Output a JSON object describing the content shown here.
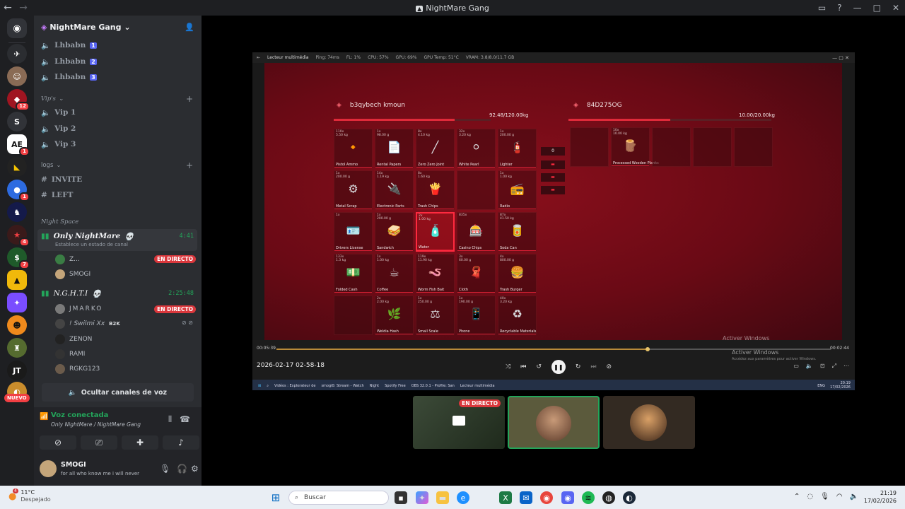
{
  "window": {
    "title": "NightMare Gang"
  },
  "guild": {
    "name": "NightMare Gang"
  },
  "channels": {
    "top": [
      {
        "name": "Lhbabn",
        "tag": "1"
      },
      {
        "name": "Lhbabn",
        "tag": "2"
      },
      {
        "name": "Lhbabn",
        "tag": "3"
      }
    ],
    "vip_category": "Vip's",
    "vip": [
      "Vip 1",
      "Vip 2",
      "Vip 3"
    ],
    "logs_category": "logs",
    "text": [
      "INVITE",
      "LEFT"
    ],
    "night_category": "Night Space",
    "voice1": {
      "name": "Only NightMare",
      "status": "Establece un estado de canal",
      "timer": "4:41",
      "users": [
        {
          "name": "Z...",
          "live": "EN DIRECTO"
        },
        {
          "name": "SMOGI",
          "live": ""
        }
      ]
    },
    "voice2": {
      "name": "N.G.H.T.I",
      "timer": "2:25:48",
      "users": [
        {
          "name": "JMARKO",
          "live": "EN DIRECTO"
        },
        {
          "name": "! Swilmi Xx",
          "tag": "B2K",
          "live": ""
        },
        {
          "name": "ZENON",
          "live": ""
        },
        {
          "name": "RAMI",
          "live": ""
        },
        {
          "name": "RGKG123",
          "live": ""
        }
      ]
    },
    "hide_voice": "Ocultar canales de voz"
  },
  "server_badges": {
    "b1": "12",
    "b2": "1",
    "b3": "1",
    "b4": "4",
    "b5": "7",
    "nuevo": "NUEVO"
  },
  "voice_panel": {
    "status": "Voz conectada",
    "channel": "Only NightMare / NightMare Gang"
  },
  "user": {
    "name": "SMOGI",
    "status": "for all who know me i will never"
  },
  "player": {
    "title": "Lecteur multimédia",
    "stats": [
      "Ping: 74ms",
      "FL: 1%",
      "CPU: 57%",
      "GPU: 69%",
      "GPU Temp: 51°C",
      "VRAM: 3.8/8.0/11.7 GB"
    ],
    "left_inv": {
      "name": "b3qybech kmoun",
      "weight": "92.48/120.00kg",
      "fill": 0.77
    },
    "right_inv": {
      "name": "84D275OG",
      "weight": "10.00/20.00kg",
      "fill": 0.5
    },
    "items": [
      {
        "q": "110x\n5.50 kg",
        "name": "Pistol Ammo",
        "icon": "🔸"
      },
      {
        "q": "1x\n98.00 g",
        "name": "Rental Papers",
        "icon": "📄"
      },
      {
        "q": "8x\n4.10 kg",
        "name": "Zero Zero Joint",
        "icon": "╱"
      },
      {
        "q": "32x\n3.20 kg",
        "name": "White Pearl",
        "icon": "⚪"
      },
      {
        "q": "1x\n200.00 g",
        "name": "Lighter",
        "icon": "🧯"
      },
      {
        "q": "1x\n200.00 g",
        "name": "Metal Scrap",
        "icon": "⚙"
      },
      {
        "q": "14x\n1.19 kg",
        "name": "Electronic Parts",
        "icon": "🔌"
      },
      {
        "q": "8x\n1.60 kg",
        "name": "Trash Chips",
        "icon": "🍟"
      },
      {
        "q": "",
        "name": "",
        "icon": ""
      },
      {
        "q": "1x\n1.00 kg",
        "name": "Radio",
        "icon": "📻"
      },
      {
        "q": "1x",
        "name": "Drivers License",
        "icon": "🪪"
      },
      {
        "q": "1x\n200.00 g",
        "name": "Sandwich",
        "icon": "🥪"
      },
      {
        "q": "2x\n1.00 kg",
        "name": "Water",
        "icon": "🧴"
      },
      {
        "q": "835x",
        "name": "Casino Chips",
        "icon": "🎰"
      },
      {
        "q": "87x\n41.50 kg",
        "name": "Soda Can",
        "icon": "🥫"
      },
      {
        "q": "133x\n1.3 kg",
        "name": "Folded Cash",
        "icon": "💵"
      },
      {
        "q": "1x\n1.00 kg",
        "name": "Coffee",
        "icon": "☕"
      },
      {
        "q": "119x\n11.90 kg",
        "name": "Worm Fish Bait",
        "icon": "🪱"
      },
      {
        "q": "3x\n60.00 g",
        "name": "Cloth",
        "icon": "🧣"
      },
      {
        "q": "4x\n800.00 g",
        "name": "Trash Burger",
        "icon": "🍔"
      },
      {
        "q": "",
        "name": "",
        "icon": ""
      },
      {
        "q": "2x\n2.00 kg",
        "name": "Weldia Hash",
        "icon": "🌿"
      },
      {
        "q": "1x\n250.00 g",
        "name": "Small Scale",
        "icon": "⚖"
      },
      {
        "q": "1x\n190.00 g",
        "name": "Phone",
        "icon": "📱"
      },
      {
        "q": "40x\n3.20 kg",
        "name": "Recyclable Materials",
        "icon": "♻"
      }
    ],
    "right_items": [
      {
        "q": "",
        "name": "",
        "icon": ""
      },
      {
        "q": "10x\n10.00 kg",
        "name": "Processed Wooden Planks",
        "icon": "🪵"
      },
      {
        "q": "",
        "name": "",
        "icon": ""
      },
      {
        "q": "",
        "name": "",
        "icon": ""
      },
      {
        "q": "",
        "name": "",
        "icon": ""
      }
    ],
    "qty_input": "0",
    "time_current": "00:05:39",
    "time_total": "00:02:44",
    "progress": 0.67,
    "datetime": "2026-02-17 02-58-18",
    "activate": "Activer Windows",
    "activate_sub": "Accédez aux paramètres pour activer Windows.",
    "inner_tasks": [
      "Vidéos : Explorateur de",
      "smogi0: Stream - Watch",
      "Night",
      "Spotify Free",
      "OBS 32.0.1 - Profile: San",
      "Lecteur multimédia"
    ],
    "inner_lang": "ENG",
    "inner_time": "20:19",
    "inner_date": "17/02/2026"
  },
  "thumbs": {
    "live": "EN DIRECTO"
  },
  "taskbar": {
    "temp": "11°C",
    "weather": "Despejado",
    "weather_badge": "4",
    "search": "Buscar",
    "time": "21:19",
    "date": "17/02/2026"
  }
}
